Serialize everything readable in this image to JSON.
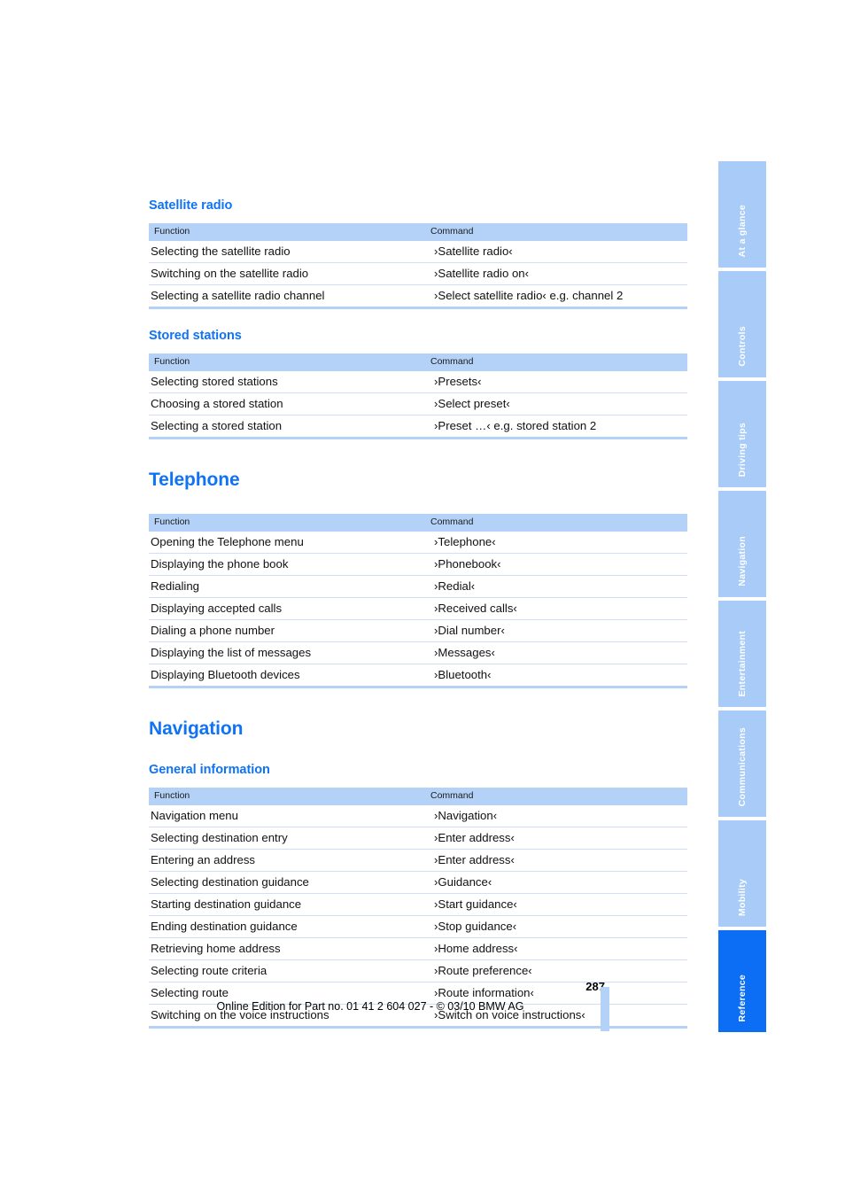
{
  "document": {
    "page_number": "287",
    "edition_line": "Online Edition for Part no. 01 41 2 604 027 - © 03/10 BMW AG"
  },
  "colors": {
    "heading_blue": "#1073f5",
    "table_header_bg": "#b4d2f7",
    "row_rule": "#cfe1f8",
    "tab_inactive": "#a8cbf7",
    "tab_active": "#0b6ef5"
  },
  "table_headers": {
    "function": "Function",
    "command": "Command"
  },
  "sections": [
    {
      "id": "satellite-radio",
      "level": "h2",
      "title": "Satellite radio",
      "rows": [
        {
          "function": "Selecting the satellite radio",
          "command": "›Satellite radio‹"
        },
        {
          "function": "Switching on the satellite radio",
          "command": "›Satellite radio on‹"
        },
        {
          "function": "Selecting a satellite radio channel",
          "command": "›Select satellite radio‹ e.g. channel 2"
        }
      ]
    },
    {
      "id": "stored-stations",
      "level": "h2",
      "title": "Stored stations",
      "rows": [
        {
          "function": "Selecting stored stations",
          "command": "›Presets‹"
        },
        {
          "function": "Choosing a stored station",
          "command": "›Select preset‹"
        },
        {
          "function": "Selecting a stored station",
          "command": "›Preset …‹ e.g. stored station 2"
        }
      ]
    },
    {
      "id": "telephone",
      "level": "h1",
      "title": "Telephone",
      "rows": [
        {
          "function": "Opening the Telephone menu",
          "command": "›Telephone‹"
        },
        {
          "function": "Displaying the phone book",
          "command": "›Phonebook‹"
        },
        {
          "function": "Redialing",
          "command": "›Redial‹"
        },
        {
          "function": "Displaying accepted calls",
          "command": "›Received calls‹"
        },
        {
          "function": "Dialing a phone number",
          "command": "›Dial number‹"
        },
        {
          "function": "Displaying the list of messages",
          "command": "›Messages‹"
        },
        {
          "function": "Displaying Bluetooth devices",
          "command": "›Bluetooth‹"
        }
      ]
    },
    {
      "id": "navigation",
      "level": "h1",
      "title": "Navigation",
      "rows": []
    },
    {
      "id": "general-information",
      "level": "h2",
      "title": "General information",
      "rows": [
        {
          "function": "Navigation menu",
          "command": "›Navigation‹"
        },
        {
          "function": "Selecting destination entry",
          "command": "›Enter address‹"
        },
        {
          "function": "Entering an address",
          "command": "›Enter address‹"
        },
        {
          "function": "Selecting destination guidance",
          "command": "›Guidance‹"
        },
        {
          "function": "Starting destination guidance",
          "command": "›Start guidance‹"
        },
        {
          "function": "Ending destination guidance",
          "command": "›Stop guidance‹"
        },
        {
          "function": "Retrieving home address",
          "command": "›Home address‹"
        },
        {
          "function": "Selecting route criteria",
          "command": "›Route preference‹"
        },
        {
          "function": "Selecting route",
          "command": "›Route information‹"
        },
        {
          "function": "Switching on the voice instructions",
          "command": "›Switch on voice instructions‹"
        }
      ]
    }
  ],
  "sidebar_tabs": [
    {
      "label": "At a glance",
      "active": false
    },
    {
      "label": "Controls",
      "active": false
    },
    {
      "label": "Driving tips",
      "active": false
    },
    {
      "label": "Navigation",
      "active": false
    },
    {
      "label": "Entertainment",
      "active": false
    },
    {
      "label": "Communications",
      "active": false
    },
    {
      "label": "Mobility",
      "active": false
    },
    {
      "label": "Reference",
      "active": true
    }
  ]
}
